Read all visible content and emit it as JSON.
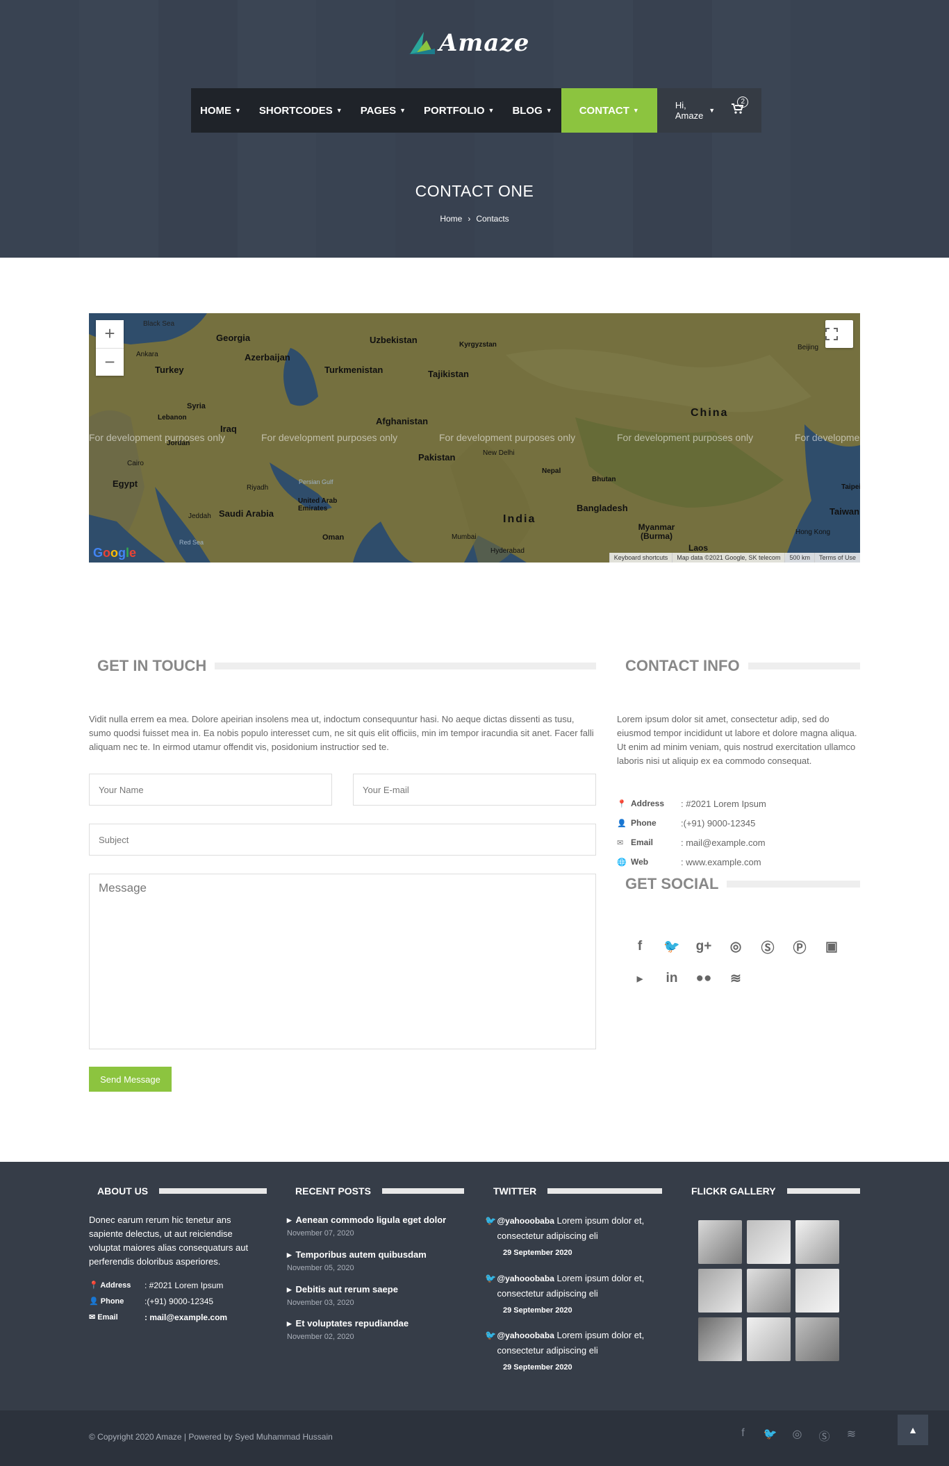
{
  "brand": {
    "name": "Amaze"
  },
  "nav": {
    "items": [
      {
        "label": "HOME"
      },
      {
        "label": "SHORTCODES"
      },
      {
        "label": "PAGES"
      },
      {
        "label": "PORTFOLIO"
      },
      {
        "label": "BLOG"
      },
      {
        "label": "CONTACT"
      }
    ],
    "user_greeting": "Hi, Amaze",
    "cart_count": "2"
  },
  "page": {
    "title": "CONTACT ONE",
    "breadcrumb": [
      "Home",
      "Contacts"
    ],
    "breadcrumb_sep": "›"
  },
  "map": {
    "watermark": "For development purposes only",
    "labels": [
      "Black Sea",
      "Georgia",
      "Uzbekistan",
      "Kyrgyzstan",
      "Ankara",
      "Azerbaijan",
      "Turkey",
      "Turkmenistan",
      "Tajikistan",
      "Beijing",
      "Syria",
      "Lebanon",
      "Iraq",
      "Afghanistan",
      "China",
      "Jordan",
      "Pakistan",
      "New Delhi",
      "Cairo",
      "Egypt",
      "Nepal",
      "Bhutan",
      "Riyadh",
      "Persian Gulf",
      "Saudi Arabia",
      "United Arab Emirates",
      "Bangladesh",
      "Taipei",
      "Taiwan",
      "Jeddah",
      "India",
      "Myanmar (Burma)",
      "Oman",
      "Mumbai",
      "Hong Kong",
      "Red Sea",
      "Hyderabad",
      "Laos"
    ],
    "footer": [
      "Keyboard shortcuts",
      "Map data ©2021 Google, SK telecom",
      "500 km",
      "Terms of Use"
    ],
    "provider": "Google"
  },
  "get_in_touch": {
    "heading": "GET IN TOUCH",
    "intro": "Vidit nulla errem ea mea. Dolore apeirian insolens mea ut, indoctum consequuntur hasi. No aeque dictas dissenti as tusu, sumo quodsi fuisset mea in. Ea nobis populo interesset cum, ne sit quis elit officiis, min im tempor iracundia sit anet. Facer falli aliquam nec te. In eirmod utamur offendit vis, posidonium instructior sed te.",
    "name_placeholder": "Your Name",
    "email_placeholder": "Your E-mail",
    "subject_placeholder": "Subject",
    "message_placeholder": "Message",
    "send_label": "Send Message"
  },
  "contact_info": {
    "heading": "CONTACT INFO",
    "text": "Lorem ipsum dolor sit amet, consectetur adip, sed do eiusmod tempor incididunt ut labore et dolore magna aliqua. Ut enim ad minim veniam, quis nostrud exercitation ullamco laboris nisi ut aliquip ex ea commodo consequat.",
    "rows": [
      {
        "label": "Address",
        "value": ": #2021 Lorem Ipsum"
      },
      {
        "label": "Phone",
        "value": ":(+91) 9000-12345"
      },
      {
        "label": "Email",
        "value": ": mail@example.com"
      },
      {
        "label": "Web",
        "value": ": www.example.com"
      }
    ]
  },
  "get_social": {
    "heading": "GET SOCIAL"
  },
  "footer": {
    "about": {
      "heading": "ABOUT US",
      "text": "Donec earum rerum hic tenetur ans sapiente delectus, ut aut reiciendise voluptat maiores alias consequaturs aut perferendis doloribus asperiores.",
      "rows": [
        {
          "label": "Address",
          "value": ": #2021 Lorem Ipsum"
        },
        {
          "label": "Phone",
          "value": ":(+91) 9000-12345"
        },
        {
          "label": "Email",
          "value": ": mail@example.com"
        }
      ]
    },
    "recent_posts": {
      "heading": "RECENT POSTS",
      "posts": [
        {
          "title": "Aenean commodo ligula eget dolor",
          "date": "November 07, 2020"
        },
        {
          "title": "Temporibus autem quibusdam",
          "date": "November 05, 2020"
        },
        {
          "title": "Debitis aut rerum saepe",
          "date": "November 03, 2020"
        },
        {
          "title": "Et voluptates repudiandae",
          "date": "November 02, 2020"
        }
      ]
    },
    "twitter": {
      "heading": "TWITTER",
      "tweets": [
        {
          "handle": "@yahooobaba",
          "text": " Lorem ipsum dolor et, consectetur adipiscing eli",
          "date": "29 September 2020"
        },
        {
          "handle": "@yahooobaba",
          "text": " Lorem ipsum dolor et, consectetur adipiscing eli",
          "date": "29 September 2020"
        },
        {
          "handle": "@yahooobaba",
          "text": " Lorem ipsum dolor et, consectetur adipiscing eli",
          "date": "29 September 2020"
        }
      ]
    },
    "flickr": {
      "heading": "FLICKR GALLERY"
    },
    "copyright": "© Copyright 2020 Amaze | Powered by Syed Muhammad Hussain"
  },
  "colors": {
    "accent": "#8cc43f",
    "nav_dark": "#1f2329",
    "footer": "#363d48",
    "footer_bottom": "#2c323c"
  }
}
